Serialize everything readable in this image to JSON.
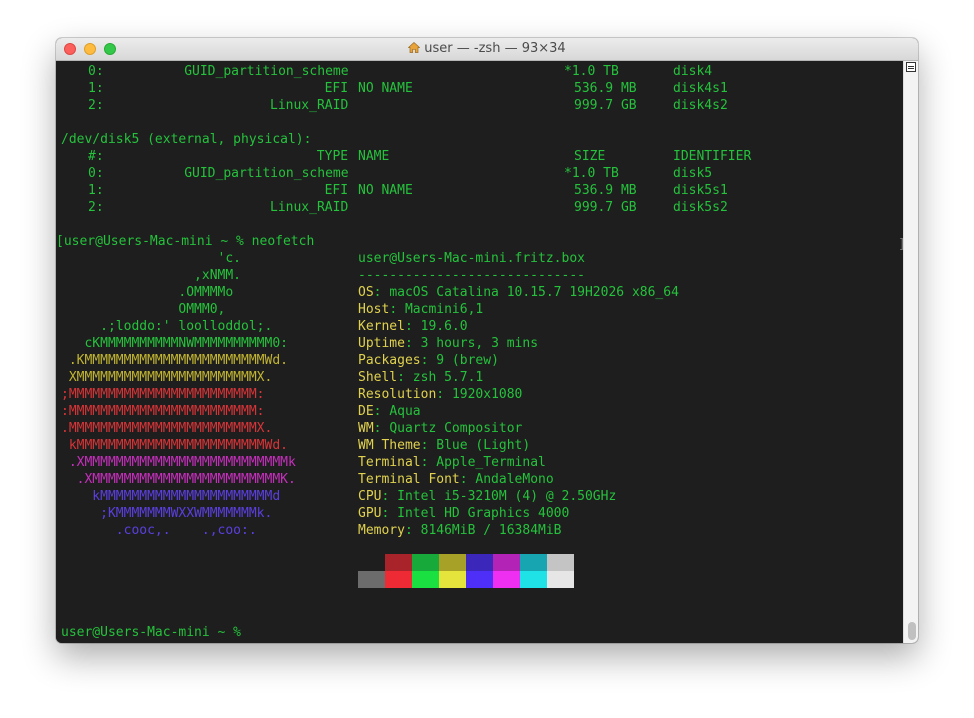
{
  "window": {
    "title": "user — -zsh — 93×34"
  },
  "disk4_rows": [
    {
      "num": "0:",
      "type": "GUID_partition_scheme",
      "name": "",
      "size": "*1.0 TB",
      "id": "disk4"
    },
    {
      "num": "1:",
      "type": "EFI",
      "name": "NO NAME",
      "size": "536.9 MB",
      "id": "disk4s1"
    },
    {
      "num": "2:",
      "type": "Linux_RAID",
      "name": "",
      "size": "999.7 GB",
      "id": "disk4s2"
    }
  ],
  "disk5": {
    "header": "/dev/disk5 (external, physical):",
    "columns": {
      "num": "#:",
      "type": "TYPE",
      "name": "NAME",
      "size": "SIZE",
      "id": "IDENTIFIER"
    },
    "rows": [
      {
        "num": "0:",
        "type": "GUID_partition_scheme",
        "name": "",
        "size": "*1.0 TB",
        "id": "disk5"
      },
      {
        "num": "1:",
        "type": "EFI",
        "name": "NO NAME",
        "size": "536.9 MB",
        "id": "disk5s1"
      },
      {
        "num": "2:",
        "type": "Linux_RAID",
        "name": "",
        "size": "999.7 GB",
        "id": "disk5s2"
      }
    ]
  },
  "prompt_cmd": "[user@Users-Mac-mini ~ % neofetch",
  "final_prompt": "user@Users-Mac-mini ~ % ",
  "neofetch": {
    "userhost": "user@Users-Mac-mini.fritz.box",
    "divider": "-----------------------------",
    "info": [
      {
        "label": "OS",
        "value": "macOS Catalina 10.15.7 19H2026 x86_64"
      },
      {
        "label": "Host",
        "value": "Macmini6,1"
      },
      {
        "label": "Kernel",
        "value": "19.6.0"
      },
      {
        "label": "Uptime",
        "value": "3 hours, 3 mins"
      },
      {
        "label": "Packages",
        "value": "9 (brew)"
      },
      {
        "label": "Shell",
        "value": "zsh 5.7.1"
      },
      {
        "label": "Resolution",
        "value": "1920x1080"
      },
      {
        "label": "DE",
        "value": "Aqua"
      },
      {
        "label": "WM",
        "value": "Quartz Compositor"
      },
      {
        "label": "WM Theme",
        "value": "Blue (Light)"
      },
      {
        "label": "Terminal",
        "value": "Apple_Terminal"
      },
      {
        "label": "Terminal Font",
        "value": "AndaleMono"
      },
      {
        "label": "CPU",
        "value": "Intel i5-3210M (4) @ 2.50GHz"
      },
      {
        "label": "GPU",
        "value": "Intel HD Graphics 4000"
      },
      {
        "label": "Memory",
        "value": "8146MiB / 16384MiB"
      }
    ],
    "logo": [
      {
        "text": "                    'c.",
        "color": "#25c23c"
      },
      {
        "text": "                 ,xNMM.",
        "color": "#25c23c"
      },
      {
        "text": "               .OMMMMo",
        "color": "#25c23c"
      },
      {
        "text": "               OMMM0,",
        "color": "#25c23c"
      },
      {
        "text": "     .;loddo:' loolloddol;.",
        "color": "#25c23c"
      },
      {
        "text": "   cKMMMMMMMMMMNWMMMMMMMMMM0:",
        "color": "#25c23c"
      },
      {
        "text": " .KMMMMMMMMMMMMMMMMMMMMMMMWd.",
        "color": "#c2b531"
      },
      {
        "text": " XMMMMMMMMMMMMMMMMMMMMMMMX.",
        "color": "#c2b531"
      },
      {
        "text": ";MMMMMMMMMMMMMMMMMMMMMMMM:",
        "color": "#d93437"
      },
      {
        "text": ":MMMMMMMMMMMMMMMMMMMMMMMM:",
        "color": "#d93437"
      },
      {
        "text": ".MMMMMMMMMMMMMMMMMMMMMMMMX.",
        "color": "#d93437"
      },
      {
        "text": " kMMMMMMMMMMMMMMMMMMMMMMMMWd.",
        "color": "#d93437"
      },
      {
        "text": " .XMMMMMMMMMMMMMMMMMMMMMMMMMMk",
        "color": "#c72fbe"
      },
      {
        "text": "  .XMMMMMMMMMMMMMMMMMMMMMMMMK.",
        "color": "#c72fbe"
      },
      {
        "text": "    kMMMMMMMMMMMMMMMMMMMMMMd",
        "color": "#5b3fe0"
      },
      {
        "text": "     ;KMMMMMMMWXXWMMMMMMMk.",
        "color": "#5b3fe0"
      },
      {
        "text": "       .cooc,.    .,coo:.",
        "color": "#5b3fe0"
      }
    ],
    "palette_top": [
      "#1e1e1e",
      "#a9232b",
      "#17a939",
      "#a8a128",
      "#3b27b9",
      "#b223b6",
      "#17a6b1",
      "#c4c4c4"
    ],
    "palette_bottom": [
      "#6c6c6c",
      "#ee2b35",
      "#1ae042",
      "#e4e43c",
      "#4d2ff7",
      "#ee2ef0",
      "#1fe2e6",
      "#e6e6e6"
    ]
  },
  "colors": {
    "terminal_bg": "#1e1e1e",
    "text_green": "#25c23c",
    "label_yellow": "#e0d24e"
  }
}
